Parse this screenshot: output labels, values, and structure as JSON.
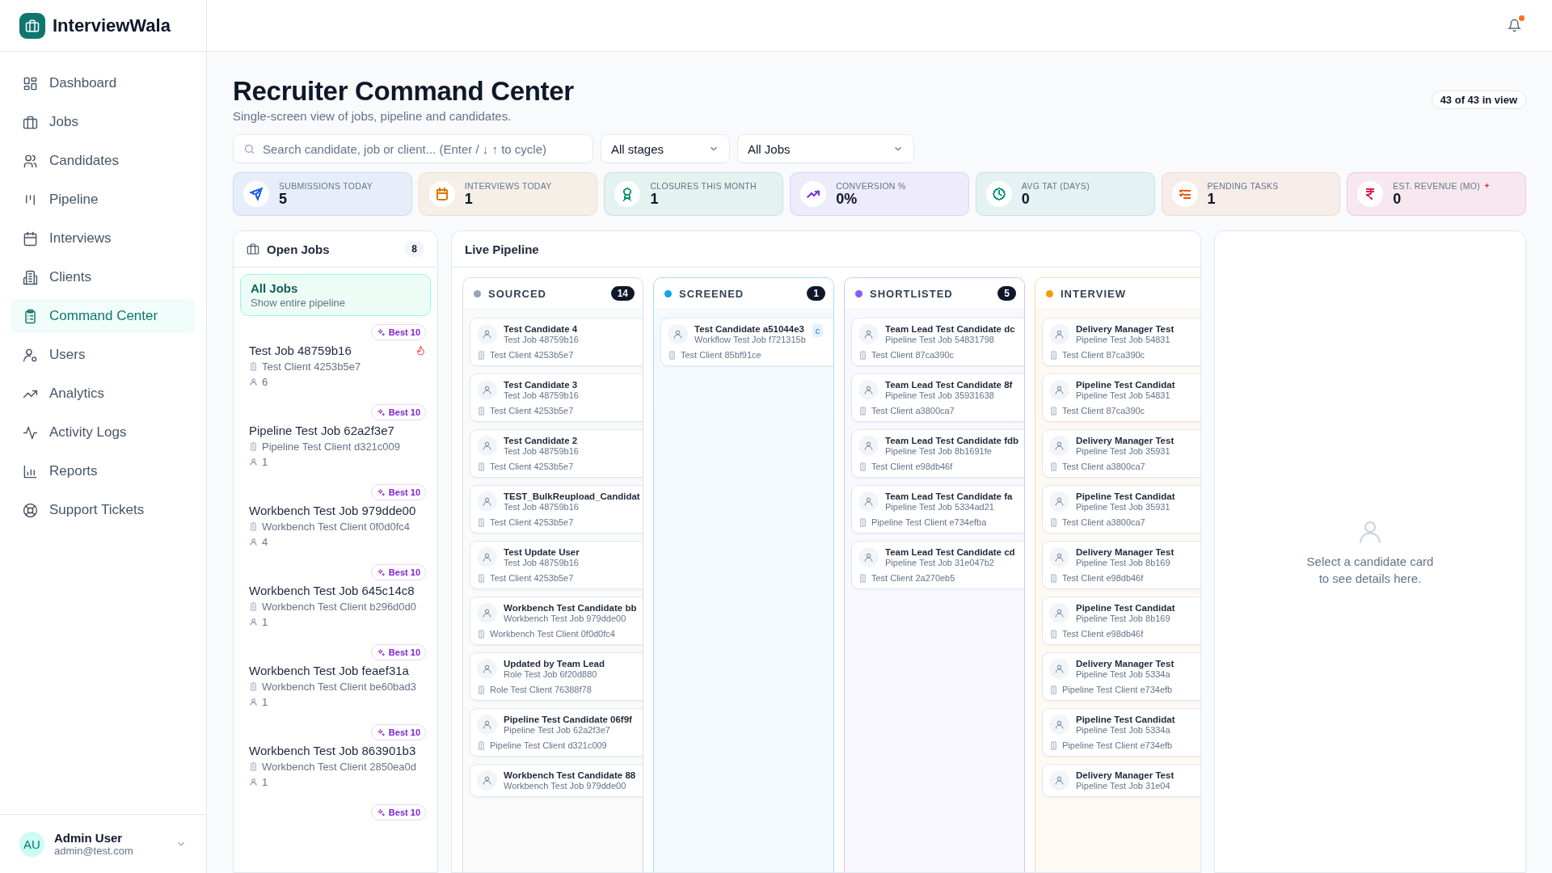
{
  "brand": {
    "name": "InterviewWala"
  },
  "nav": [
    {
      "label": "Dashboard",
      "selected": false
    },
    {
      "label": "Jobs",
      "selected": false
    },
    {
      "label": "Candidates",
      "selected": false
    },
    {
      "label": "Pipeline",
      "selected": false
    },
    {
      "label": "Interviews",
      "selected": false
    },
    {
      "label": "Clients",
      "selected": false
    },
    {
      "label": "Command Center",
      "selected": true
    },
    {
      "label": "Users",
      "selected": false
    },
    {
      "label": "Analytics",
      "selected": false
    },
    {
      "label": "Activity Logs",
      "selected": false
    },
    {
      "label": "Reports",
      "selected": false
    },
    {
      "label": "Support Tickets",
      "selected": false
    }
  ],
  "user": {
    "initials": "AU",
    "name": "Admin User",
    "email": "admin@test.com"
  },
  "header": {
    "notification": true
  },
  "page": {
    "title": "Recruiter Command Center",
    "subtitle": "Single-screen view of jobs, pipeline and candidates.",
    "in_view": "43 of 43 in view"
  },
  "filters": {
    "search_placeholder": "Search candidate, job or client... (Enter / ↓ ↑ to cycle)",
    "stage": "All stages",
    "job": "All Jobs"
  },
  "stats": [
    {
      "label": "SUBMISSIONS TODAY",
      "value": "5",
      "color": "#2563eb"
    },
    {
      "label": "INTERVIEWS TODAY",
      "value": "1",
      "color": "#d97706"
    },
    {
      "label": "CLOSURES THIS MONTH",
      "value": "1",
      "color": "#059669"
    },
    {
      "label": "CONVERSION %",
      "value": "0%",
      "color": "#7c3aed"
    },
    {
      "label": "AVG TAT (DAYS)",
      "value": "0",
      "color": "#0d9488"
    },
    {
      "label": "PENDING TASKS",
      "value": "1",
      "color": "#ea580c"
    },
    {
      "label": "EST. REVENUE (MO)",
      "value": "0",
      "color": "#e11d48",
      "flag": true
    }
  ],
  "open_jobs": {
    "title": "Open Jobs",
    "count": "8",
    "all": {
      "title": "All Jobs",
      "subtitle": "Show entire pipeline",
      "selected": true
    },
    "items": [
      {
        "badge": "Best 10",
        "title": "Test Job 48759b16",
        "client": "Test Client 4253b5e7",
        "candidates": "6",
        "hot": true
      },
      {
        "badge": "Best 10",
        "title": "Pipeline Test Job 62a2f3e7",
        "client": "Pipeline Test Client d321c009",
        "candidates": "1",
        "hot": false
      },
      {
        "badge": "Best 10",
        "title": "Workbench Test Job 979dde00",
        "client": "Workbench Test Client 0f0d0fc4",
        "candidates": "4",
        "hot": false
      },
      {
        "badge": "Best 10",
        "title": "Workbench Test Job 645c14c8",
        "client": "Workbench Test Client b296d0d0",
        "candidates": "1",
        "hot": false
      },
      {
        "badge": "Best 10",
        "title": "Workbench Test Job feaef31a",
        "client": "Workbench Test Client be60bad3",
        "candidates": "1",
        "hot": false
      },
      {
        "badge": "Best 10",
        "title": "Workbench Test Job 863901b3",
        "client": "Workbench Test Client 2850ea0d",
        "candidates": "1",
        "hot": false
      },
      {
        "badge": "Best 10"
      }
    ]
  },
  "pipeline": {
    "title": "Live Pipeline",
    "columns": [
      {
        "label": "SOURCED",
        "count": "14",
        "color": "#94a3b8",
        "cards": [
          {
            "name": "Test Candidate 4",
            "job": "Test Job 48759b16",
            "client": "Test Client 4253b5e7"
          },
          {
            "name": "Test Candidate 3",
            "job": "Test Job 48759b16",
            "client": "Test Client 4253b5e7"
          },
          {
            "name": "Test Candidate 2",
            "job": "Test Job 48759b16",
            "client": "Test Client 4253b5e7"
          },
          {
            "name": "TEST_BulkReupload_Candidat",
            "job": "Test Job 48759b16",
            "client": "Test Client 4253b5e7"
          },
          {
            "name": "Test Update User",
            "job": "Test Job 48759b16",
            "client": "Test Client 4253b5e7"
          },
          {
            "name": "Workbench Test Candidate bb",
            "job": "Workbench Test Job 979dde00",
            "client": "Workbench Test Client 0f0d0fc4"
          },
          {
            "name": "Updated by Team Lead",
            "job": "Role Test Job 6f20d880",
            "client": "Role Test Client 76388f78"
          },
          {
            "name": "Pipeline Test Candidate 06f9f",
            "job": "Pipeline Test Job 62a2f3e7",
            "client": "Pipeline Test Client d321c009"
          },
          {
            "name": "Workbench Test Candidate 88",
            "job": "Workbench Test Job 979dde00"
          }
        ]
      },
      {
        "label": "SCREENED",
        "count": "1",
        "color": "#0ea5e9",
        "cards": [
          {
            "name": "Test Candidate a51044e3",
            "job": "Workflow Test Job f721315b",
            "client": "Test Client 85bf91ce",
            "tag": "c"
          }
        ]
      },
      {
        "label": "SHORTLISTED",
        "count": "5",
        "color": "#8b5cf6",
        "cards": [
          {
            "name": "Team Lead Test Candidate dc",
            "job": "Pipeline Test Job 54831798",
            "client": "Test Client 87ca390c"
          },
          {
            "name": "Team Lead Test Candidate 8f",
            "job": "Pipeline Test Job 35931638",
            "client": "Test Client a3800ca7"
          },
          {
            "name": "Team Lead Test Candidate fdb",
            "job": "Pipeline Test Job 8b1691fe",
            "client": "Test Client e98db46f"
          },
          {
            "name": "Team Lead Test Candidate fa",
            "job": "Pipeline Test Job 5334ad21",
            "client": "Pipeline Test Client e734efba"
          },
          {
            "name": "Team Lead Test Candidate cd",
            "job": "Pipeline Test Job 31e047b2",
            "client": "Test Client 2a270eb5"
          }
        ]
      },
      {
        "label": "INTERVIEW",
        "color": "#f59e0b",
        "cards": [
          {
            "name": "Delivery Manager Test",
            "job": "Pipeline Test Job 54831",
            "client": "Test Client 87ca390c"
          },
          {
            "name": "Pipeline Test Candidat",
            "job": "Pipeline Test Job 54831",
            "client": "Test Client 87ca390c"
          },
          {
            "name": "Delivery Manager Test",
            "job": "Pipeline Test Job 35931",
            "client": "Test Client a3800ca7"
          },
          {
            "name": "Pipeline Test Candidat",
            "job": "Pipeline Test Job 35931",
            "client": "Test Client a3800ca7"
          },
          {
            "name": "Delivery Manager Test",
            "job": "Pipeline Test Job 8b169",
            "client": "Test Client e98db46f"
          },
          {
            "name": "Pipeline Test Candidat",
            "job": "Pipeline Test Job 8b169",
            "client": "Test Client e98db46f"
          },
          {
            "name": "Delivery Manager Test",
            "job": "Pipeline Test Job 5334a",
            "client": "Pipeline Test Client e734efb"
          },
          {
            "name": "Pipeline Test Candidat",
            "job": "Pipeline Test Job 5334a",
            "client": "Pipeline Test Client e734efb"
          },
          {
            "name": "Delivery Manager Test",
            "job": "Pipeline Test Job 31e04"
          }
        ]
      }
    ]
  },
  "details": {
    "empty_text": "Select a candidate card to see details here."
  }
}
